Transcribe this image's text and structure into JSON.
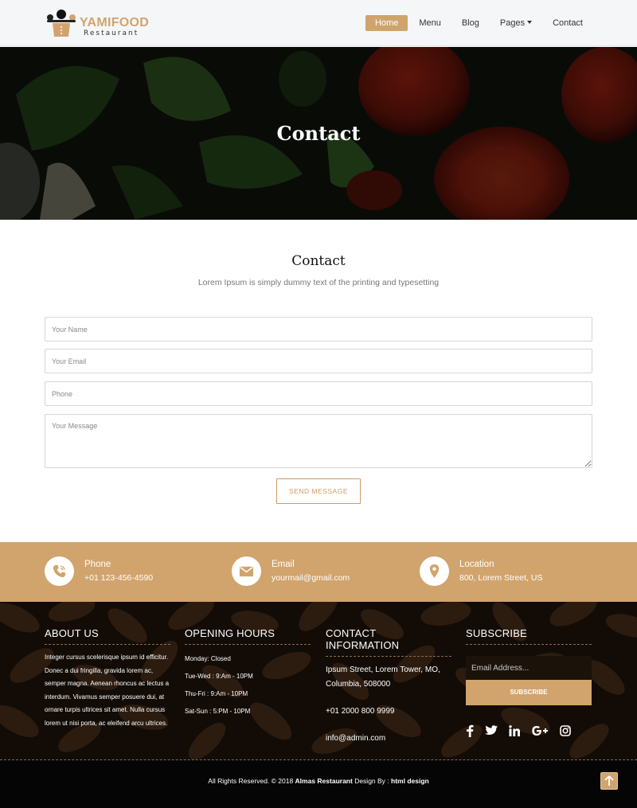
{
  "brand": {
    "name": "YAMIFOOD",
    "tagline": "Restaurant"
  },
  "nav": {
    "items": [
      {
        "label": "Home",
        "active": true
      },
      {
        "label": "Menu",
        "active": false
      },
      {
        "label": "Blog",
        "active": false
      },
      {
        "label": "Pages",
        "active": false,
        "dropdown": true
      },
      {
        "label": "Contact",
        "active": false
      }
    ]
  },
  "hero": {
    "title": "Contact"
  },
  "contact": {
    "title": "Contact",
    "subtitle": "Lorem Ipsum is simply dummy text of the printing and typesetting",
    "name_placeholder": "Your Name",
    "email_placeholder": "Your Email",
    "phone_placeholder": "Phone",
    "message_placeholder": "Your Message",
    "send_label": "SEND MESSAGE"
  },
  "info": {
    "phone": {
      "label": "Phone",
      "value": "+01 123-456-4590",
      "icon": "phone-icon"
    },
    "email": {
      "label": "Email",
      "value": "yourmail@gmail.com",
      "icon": "envelope-icon"
    },
    "location": {
      "label": "Location",
      "value": "800, Lorem Street, US",
      "icon": "map-pin-icon"
    }
  },
  "footer": {
    "about": {
      "title": "ABOUT US",
      "text": "Integer cursus scelerisque ipsum id efficitur. Donec a dui fringilla, gravida lorem ac, semper magna. Aenean rhoncus ac lectus a interdum. Vivamus semper posuere dui, at ornare turpis ultrices sit amet. Nulla cursus lorem ut nisi porta, ac eleifend arcu ultrices."
    },
    "hours": {
      "title": "OPENING HOURS",
      "lines": [
        "Monday: Closed",
        "Tue-Wed : 9:Am - 10PM",
        "Thu-Fri : 9:Am - 10PM",
        "Sat-Sun : 5:PM - 10PM"
      ]
    },
    "contact_info": {
      "title": "CONTACT INFORMATION",
      "address_line1": "Ipsum Street, Lorem Tower, MO,",
      "address_line2": "Columbia, 508000",
      "phone": "+01 2000 800 9999",
      "email": "info@admin.com"
    },
    "subscribe": {
      "title": "SUBSCRIBE",
      "placeholder": "Email Address...",
      "button": "SUBSCRIBE",
      "social_icons": [
        "facebook-icon",
        "twitter-icon",
        "linkedin-icon",
        "google-plus-icon",
        "instagram-icon"
      ]
    },
    "copyright": {
      "prefix": "All Rights Reserved. © 2018 ",
      "company": "Almas Restaurant",
      "middle": " Design By : ",
      "designer": "html design"
    }
  },
  "colors": {
    "accent": "#d1a46d",
    "nav_bg": "#f5f6f8",
    "footer_bottom": "#050505"
  }
}
